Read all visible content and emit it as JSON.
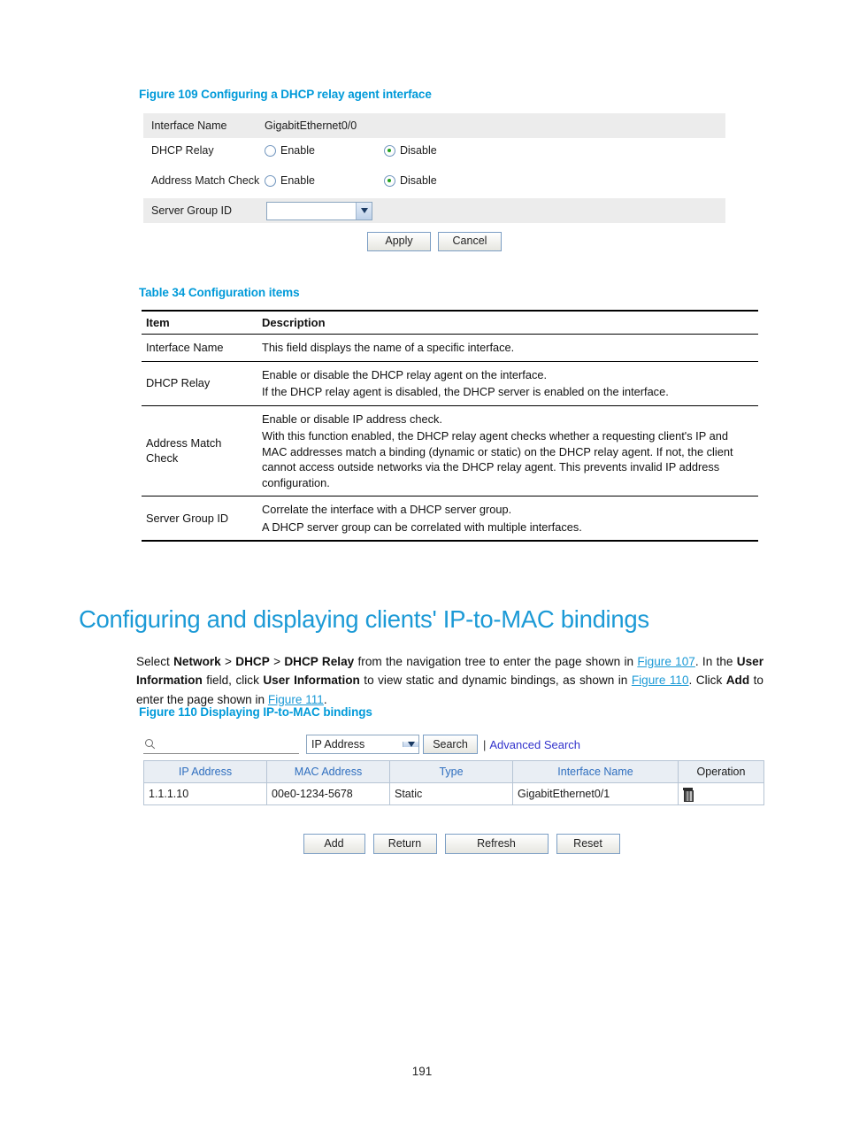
{
  "figure109": {
    "caption": "Figure 109 Configuring a DHCP relay agent interface",
    "rows": {
      "interface_name_label": "Interface Name",
      "interface_name_value": "GigabitEthernet0/0",
      "dhcp_relay_label": "DHCP Relay",
      "address_match_check_label": "Address Match Check",
      "server_group_id_label": "Server Group ID",
      "enable_label": "Enable",
      "disable_label": "Disable",
      "server_group_id_value": ""
    },
    "buttons": {
      "apply": "Apply",
      "cancel": "Cancel"
    }
  },
  "table34": {
    "caption": "Table 34 Configuration items",
    "headers": {
      "item": "Item",
      "description": "Description"
    },
    "rows": [
      {
        "item": "Interface Name",
        "lines": [
          "This field displays the name of a specific interface."
        ]
      },
      {
        "item": "DHCP Relay",
        "lines": [
          "Enable or disable the DHCP relay agent on the interface.",
          "If the DHCP relay agent is disabled, the DHCP server is enabled on the interface."
        ]
      },
      {
        "item": "Address Match Check",
        "lines": [
          "Enable or disable IP address check.",
          "With this function enabled, the DHCP relay agent checks whether a requesting client's IP and MAC addresses match a binding (dynamic or static) on the DHCP relay agent. If not, the client cannot access outside networks via the DHCP relay agent. This prevents invalid IP address configuration."
        ]
      },
      {
        "item": "Server Group ID",
        "lines": [
          "Correlate the interface with a DHCP server group.",
          "A DHCP server group can be correlated with multiple interfaces."
        ]
      }
    ]
  },
  "section": {
    "heading": "Configuring and displaying clients' IP-to-MAC bindings",
    "paragraph": {
      "t1": "Select ",
      "b1": "Network",
      "t2": " > ",
      "b2": "DHCP",
      "t3": " > ",
      "b3": "DHCP Relay",
      "t4": " from the navigation tree to enter the page shown in ",
      "x1": "Figure 107",
      "t5": ". In the ",
      "b4": "User Information",
      "t6": " field, click ",
      "b5": "User Information",
      "t7": " to view static and dynamic bindings, as shown in ",
      "x2": "Figure 110",
      "t8": ". Click ",
      "b6": "Add",
      "t9": " to enter the page shown in ",
      "x3": "Figure 111",
      "t10": "."
    }
  },
  "figure110": {
    "caption": "Figure 110 Displaying IP-to-MAC bindings",
    "search": {
      "input_value": "",
      "input_placeholder": "",
      "selected_field": "IP Address",
      "search_button": "Search",
      "separator": "|",
      "advanced_search": "Advanced Search"
    },
    "table": {
      "headers": [
        "IP Address",
        "MAC Address",
        "Type",
        "Interface Name",
        "Operation"
      ],
      "rows": [
        {
          "ip_address": "1.1.1.10",
          "mac_address": "00e0-1234-5678",
          "type": "Static",
          "interface_name": "GigabitEthernet0/1",
          "operation_icon": "trash-icon"
        }
      ]
    },
    "buttons": {
      "add": "Add",
      "return": "Return",
      "refresh": "Refresh",
      "reset": "Reset"
    }
  },
  "footer": {
    "page_number": "191"
  },
  "colors": {
    "caption_blue": "#009ad9",
    "heading_blue": "#1c9ad6",
    "link_blue": "#3333cc",
    "table_header_blue": "#2f6fbf",
    "radio_selected_green": "#23a11d"
  }
}
